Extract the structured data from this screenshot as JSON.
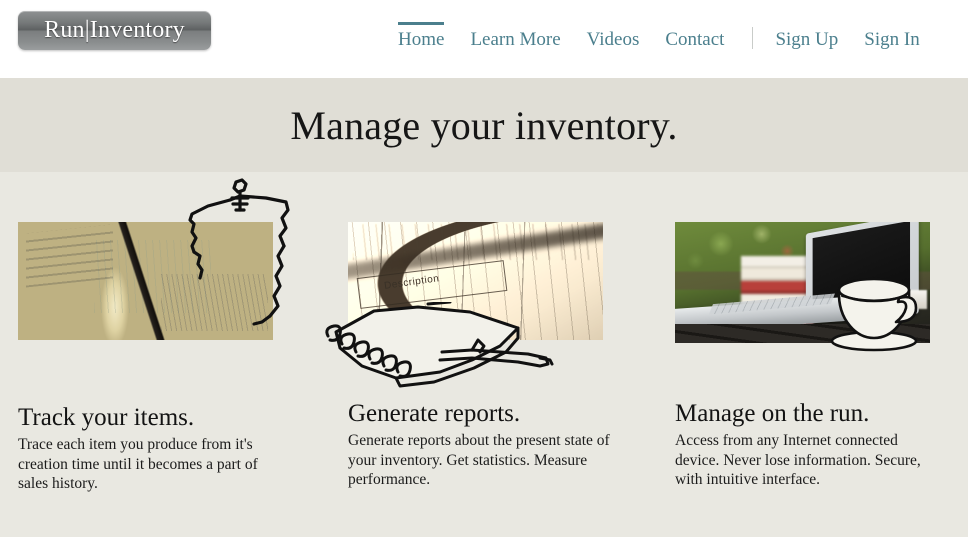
{
  "header": {
    "logo_text": "Run|Inventory",
    "nav": [
      {
        "label": "Home",
        "active": true
      },
      {
        "label": "Learn More",
        "active": false
      },
      {
        "label": "Videos",
        "active": false
      },
      {
        "label": "Contact",
        "active": false
      }
    ],
    "auth": [
      {
        "label": "Sign Up"
      },
      {
        "label": "Sign In"
      }
    ],
    "accent_color": "#4b7f8d",
    "background_color": "#ffffff"
  },
  "hero": {
    "title": "Manage your inventory.",
    "background_color": "#e0ded6",
    "text_color": "#161616"
  },
  "features": {
    "background_color": "#e9e8e1",
    "columns": [
      {
        "title": "Track your items.",
        "body": "Trace each item you produce from it's creation time until it becomes a part of sales history.",
        "photo_name": "laptop-with-notepad-and-books-photo",
        "sketch_name": "clipboard-sketch"
      },
      {
        "title": "Generate reports.",
        "body": "Generate reports about the present state of your inventory. Get statistics. Measure performance.",
        "photo_name": "report-form-with-magnifier-photo",
        "photo_label": "Description",
        "sketch_name": "spiral-notebook-and-pen-sketch"
      },
      {
        "title": "Manage on the run.",
        "body": "Access from any Internet connected device. Never lose information. Secure, with intuitive interface.",
        "photo_name": "laptop-outdoors-with-books-photo",
        "sketch_name": "coffee-cup-sketch"
      }
    ]
  }
}
